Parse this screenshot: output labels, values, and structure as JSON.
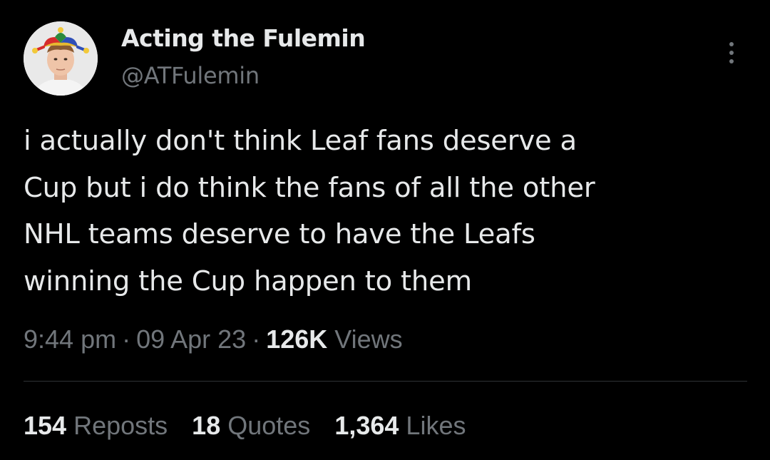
{
  "author": {
    "display_name": "Acting the Fulemin",
    "handle": "@ATFulemin",
    "avatar_icon": "jester-hat-avatar"
  },
  "tweet": {
    "text_lines": [
      "i actually don't think Leaf fans deserve a",
      "Cup but i do think the fans of all the other",
      "NHL teams deserve to have the Leafs",
      "winning the Cup happen to them"
    ]
  },
  "meta": {
    "time": "9:44 pm",
    "date": "09 Apr 23",
    "separator": "·",
    "views_count": "126K",
    "views_label": "Views"
  },
  "stats": {
    "reposts_count": "154",
    "reposts_label": "Reposts",
    "quotes_count": "18",
    "quotes_label": "Quotes",
    "likes_count": "1,364",
    "likes_label": "Likes"
  },
  "colors": {
    "background": "#000000",
    "primary_text": "#e7e9ea",
    "secondary_text": "#71767b",
    "divider": "#2f3336"
  }
}
